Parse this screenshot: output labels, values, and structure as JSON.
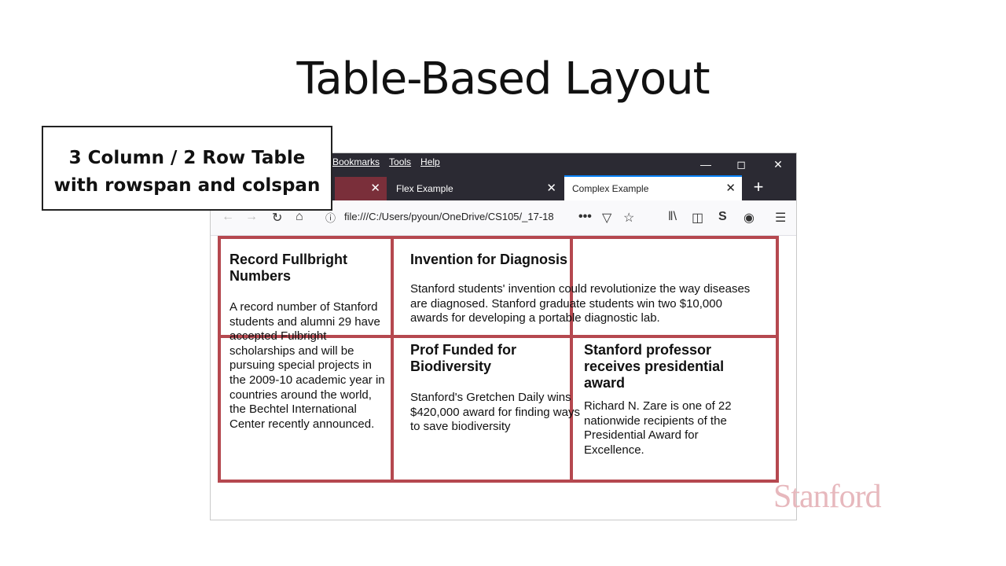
{
  "slide": {
    "title": "Table-Based Layout"
  },
  "callout": {
    "line1": "3 Column / 2 Row Table",
    "line2": "with rowspan and colspan"
  },
  "browser": {
    "menus": [
      "Bookmarks",
      "Tools",
      "Help"
    ],
    "tabs": [
      {
        "label": "",
        "active": false
      },
      {
        "label": "Flex Example",
        "active": false
      },
      {
        "label": "Complex Example",
        "active": true
      }
    ],
    "url": "file:///C:/Users/pyoun/OneDrive/CS105/_17-18"
  },
  "cells": {
    "fullbright": {
      "title": "Record Fullbright Numbers",
      "body": "A record number of Stanford students and alumni 29 have accepted Fulbright scholarships and will be pursuing special projects in the 2009-10 academic year in countries around the world, the Bechtel International Center recently announced."
    },
    "invention": {
      "title": "Invention for Diagnosis",
      "body": "Stanford students' invention could revolutionize the way diseases are diagnosed. Stanford graduate students win two $10,000 awards for developing a portable diagnostic lab."
    },
    "biodiversity": {
      "title": "Prof Funded for Biodiversity",
      "body": "Stanford's Gretchen Daily wins $420,000 award for finding ways to save biodiversity"
    },
    "award": {
      "title": "Stanford professor receives presidential award",
      "body": "Richard N. Zare is one of 22 nationwide recipients of the Presidential Award for Excellence."
    }
  },
  "watermark": "Stanford",
  "colors": {
    "grid": "#b5484f",
    "tabAccent": "#0a84ff",
    "chrome": "#2b2a33"
  }
}
